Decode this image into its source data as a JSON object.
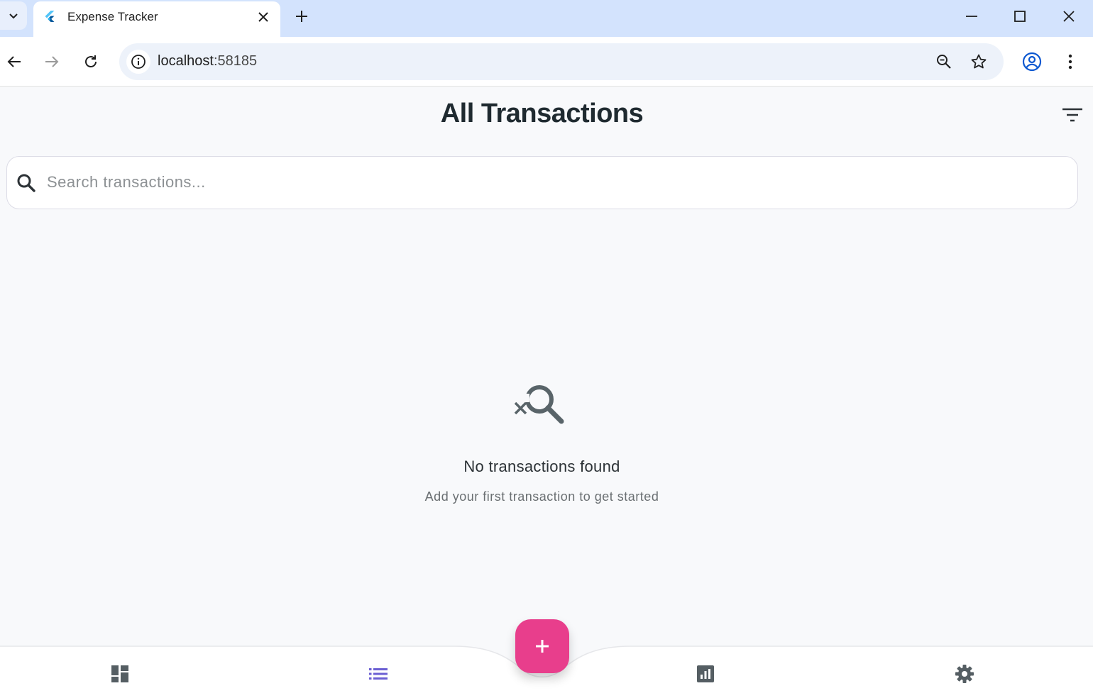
{
  "browser": {
    "tab_title": "Expense Tracker",
    "url_host": "localhost",
    "url_port": ":58185"
  },
  "app": {
    "title": "All Transactions",
    "search": {
      "placeholder": "Search transactions...",
      "value": ""
    },
    "empty_state": {
      "icon": "search-off-icon",
      "title": "No transactions found",
      "subtitle": "Add your first transaction to get started"
    },
    "bottom_nav": {
      "items": [
        {
          "icon": "dashboard-icon",
          "active": false
        },
        {
          "icon": "list-icon",
          "active": true
        },
        {
          "icon": "analytics-icon",
          "active": false
        },
        {
          "icon": "settings-icon",
          "active": false
        }
      ],
      "fab_icon": "add-icon"
    },
    "colors": {
      "accent": "#e83e8c",
      "active_nav": "#6b5fd3",
      "inactive_nav": "#555e63",
      "background": "#f8f9fb"
    }
  }
}
